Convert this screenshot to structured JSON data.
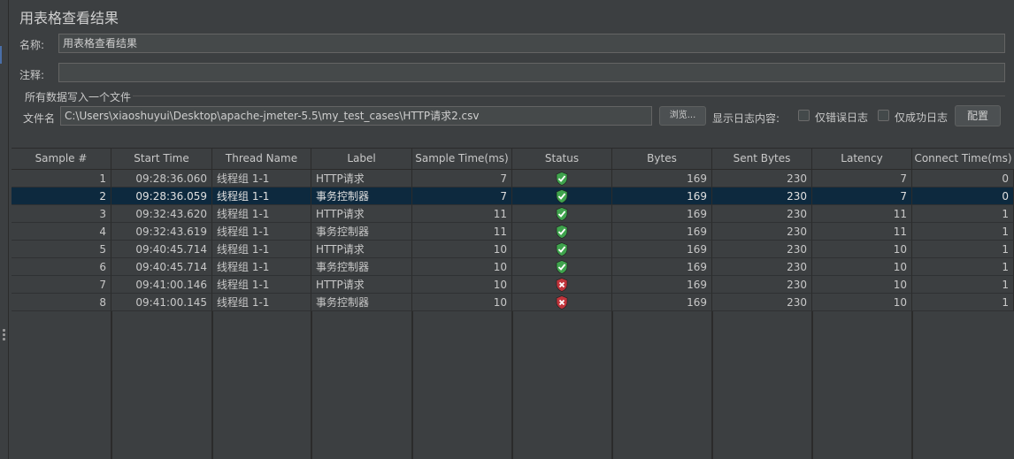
{
  "window": {
    "title": "用表格查看结果"
  },
  "name_field": {
    "label": "名称:",
    "value": "用表格查看结果"
  },
  "comment_field": {
    "label": "注释:",
    "value": ""
  },
  "file_group": {
    "title": "所有数据写入一个文件",
    "filename_label": "文件名",
    "filename_value": "C:\\Users\\xiaoshuyui\\Desktop\\apache-jmeter-5.5\\my_test_cases\\HTTP请求2.csv",
    "browse_label": "浏览...",
    "log_content_label": "显示日志内容:",
    "errors_only_label": "仅错误日志",
    "errors_only_checked": false,
    "success_only_label": "仅成功日志",
    "success_only_checked": false,
    "configure_label": "配置"
  },
  "table": {
    "columns": [
      "Sample #",
      "Start Time",
      "Thread Name",
      "Label",
      "Sample Time(ms)",
      "Status",
      "Bytes",
      "Sent Bytes",
      "Latency",
      "Connect Time(ms)"
    ],
    "selected_row": 1,
    "rows": [
      {
        "sample": "1",
        "start": "09:28:36.060",
        "thread": "线程组 1-1",
        "label": "HTTP请求",
        "time": "7",
        "status": "success",
        "bytes": "169",
        "sent": "230",
        "latency": "7",
        "connect": "0"
      },
      {
        "sample": "2",
        "start": "09:28:36.059",
        "thread": "线程组 1-1",
        "label": "事务控制器",
        "time": "7",
        "status": "success",
        "bytes": "169",
        "sent": "230",
        "latency": "7",
        "connect": "0"
      },
      {
        "sample": "3",
        "start": "09:32:43.620",
        "thread": "线程组 1-1",
        "label": "HTTP请求",
        "time": "11",
        "status": "success",
        "bytes": "169",
        "sent": "230",
        "latency": "11",
        "connect": "1"
      },
      {
        "sample": "4",
        "start": "09:32:43.619",
        "thread": "线程组 1-1",
        "label": "事务控制器",
        "time": "11",
        "status": "success",
        "bytes": "169",
        "sent": "230",
        "latency": "11",
        "connect": "1"
      },
      {
        "sample": "5",
        "start": "09:40:45.714",
        "thread": "线程组 1-1",
        "label": "HTTP请求",
        "time": "10",
        "status": "success",
        "bytes": "169",
        "sent": "230",
        "latency": "10",
        "connect": "1"
      },
      {
        "sample": "6",
        "start": "09:40:45.714",
        "thread": "线程组 1-1",
        "label": "事务控制器",
        "time": "10",
        "status": "success",
        "bytes": "169",
        "sent": "230",
        "latency": "10",
        "connect": "1"
      },
      {
        "sample": "7",
        "start": "09:41:00.146",
        "thread": "线程组 1-1",
        "label": "HTTP请求",
        "time": "10",
        "status": "failure",
        "bytes": "169",
        "sent": "230",
        "latency": "10",
        "connect": "1"
      },
      {
        "sample": "8",
        "start": "09:41:00.145",
        "thread": "线程组 1-1",
        "label": "事务控制器",
        "time": "10",
        "status": "failure",
        "bytes": "169",
        "sent": "230",
        "latency": "10",
        "connect": "1"
      }
    ]
  },
  "colors": {
    "background": "#3c3f41",
    "selected_row": "#0d293e",
    "success_shield": "#3fa34d",
    "failure_shield": "#c0343b"
  }
}
